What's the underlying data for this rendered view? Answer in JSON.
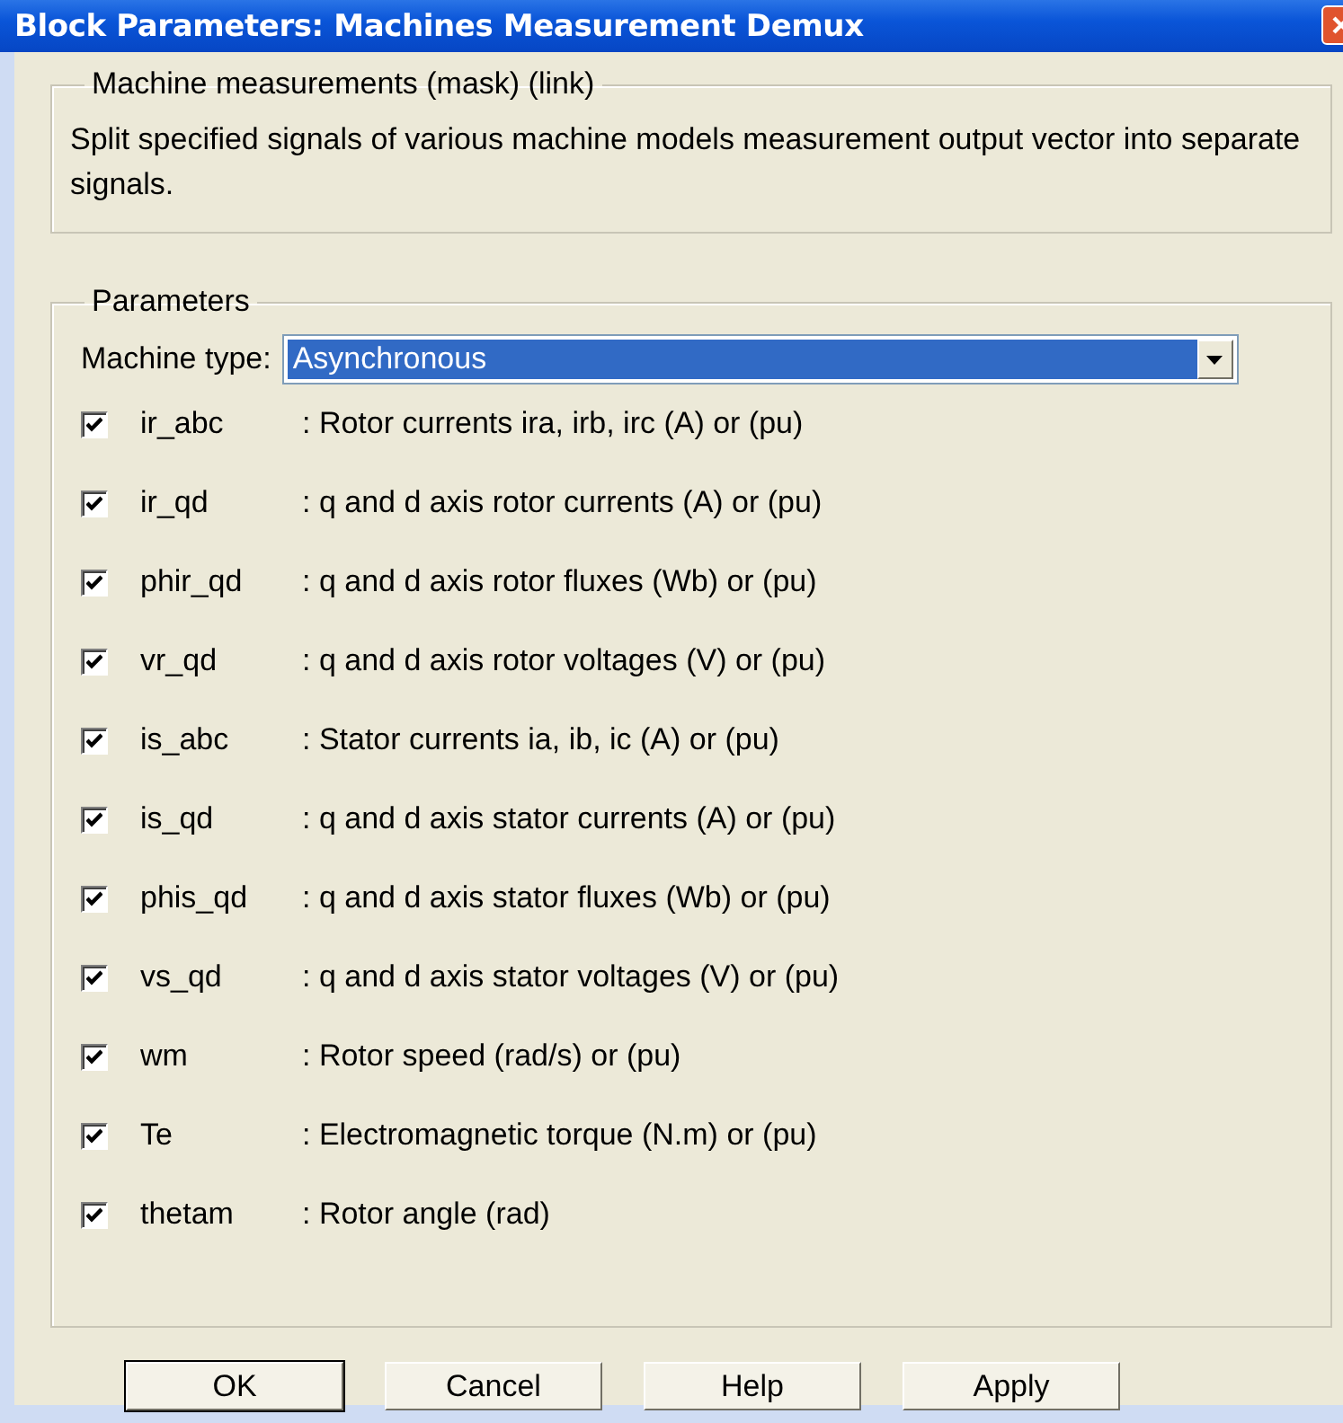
{
  "window": {
    "title": "Block Parameters: Machines Measurement Demux"
  },
  "description_group": {
    "title": "Machine measurements (mask) (link)",
    "text": "Split specified signals of various machine models measurement output vector into separate signals."
  },
  "parameters": {
    "title": "Parameters",
    "machine_type": {
      "label": "Machine type:",
      "value": "Asynchronous",
      "selected": true
    },
    "signals": [
      {
        "name": "ir_abc",
        "description": ": Rotor currents ira, irb, irc (A) or (pu)",
        "checked": true
      },
      {
        "name": "ir_qd",
        "description": ": q and d axis rotor currents (A) or (pu)",
        "checked": true
      },
      {
        "name": "phir_qd",
        "description": ": q and d axis rotor fluxes (Wb) or (pu)",
        "checked": true
      },
      {
        "name": "vr_qd",
        "description": ": q and d axis rotor voltages (V) or (pu)",
        "checked": true
      },
      {
        "name": "is_abc",
        "description": ": Stator currents ia, ib, ic (A) or (pu)",
        "checked": true
      },
      {
        "name": "is_qd",
        "description": ": q and d axis stator currents (A) or (pu)",
        "checked": true
      },
      {
        "name": "phis_qd",
        "description": ": q and d axis stator fluxes (Wb) or (pu)",
        "checked": true
      },
      {
        "name": "vs_qd",
        "description": ": q and d axis stator voltages (V) or (pu)",
        "checked": true
      },
      {
        "name": "wm",
        "description": ": Rotor speed (rad/s) or (pu)",
        "checked": true
      },
      {
        "name": "Te",
        "description": ": Electromagnetic torque (N.m) or (pu)",
        "checked": true
      },
      {
        "name": "thetam",
        "description": ": Rotor angle (rad)",
        "checked": true
      }
    ]
  },
  "buttons": [
    "OK",
    "Cancel",
    "Help",
    "Apply"
  ]
}
